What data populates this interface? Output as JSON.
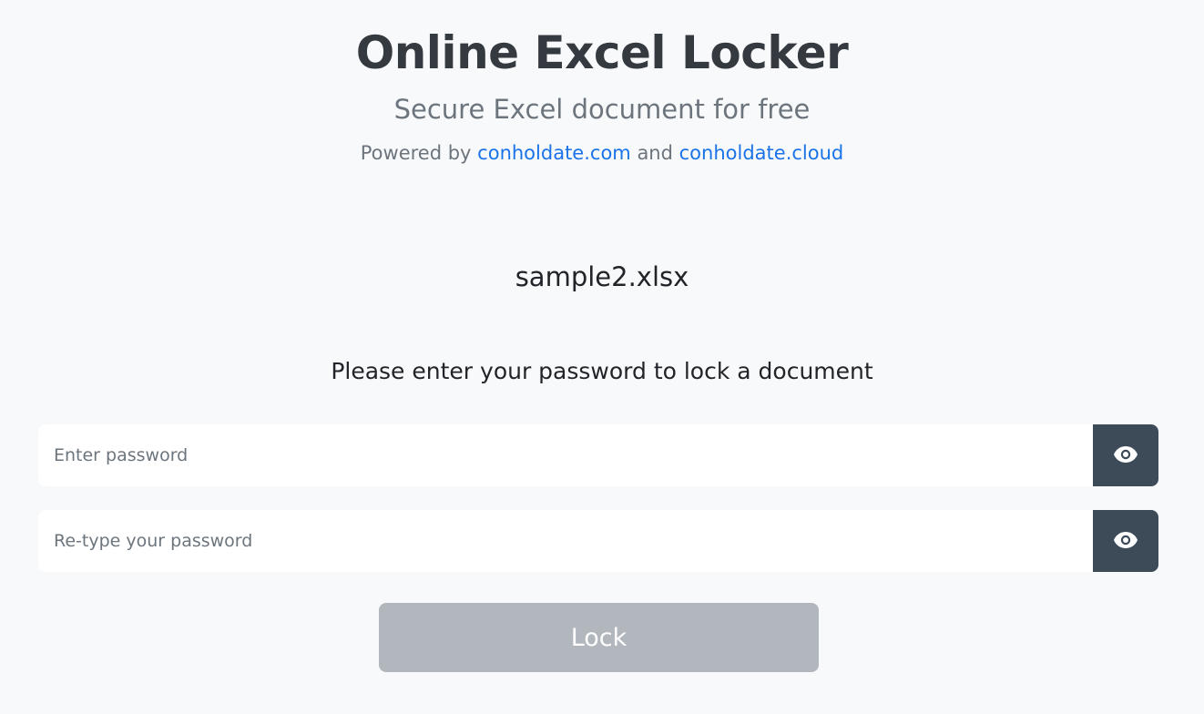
{
  "header": {
    "title": "Online Excel Locker",
    "subtitle": "Secure Excel document for free",
    "powered_prefix": "Powered by",
    "link1": "conholdate.com",
    "and": "and",
    "link2": "conholdate.cloud"
  },
  "document": {
    "filename": "sample2.xlsx"
  },
  "form": {
    "prompt": "Please enter your password to lock a document",
    "password_placeholder": "Enter password",
    "password_value": "",
    "retype_placeholder": "Re-type your password",
    "retype_value": "",
    "lock_label": "Lock"
  },
  "icons": {
    "toggle_visibility": "eye-icon"
  },
  "colors": {
    "background": "#f8f9fa",
    "link": "#1a73e8",
    "eye_button": "#3d4b59",
    "lock_button_disabled": "#b2b7be"
  }
}
